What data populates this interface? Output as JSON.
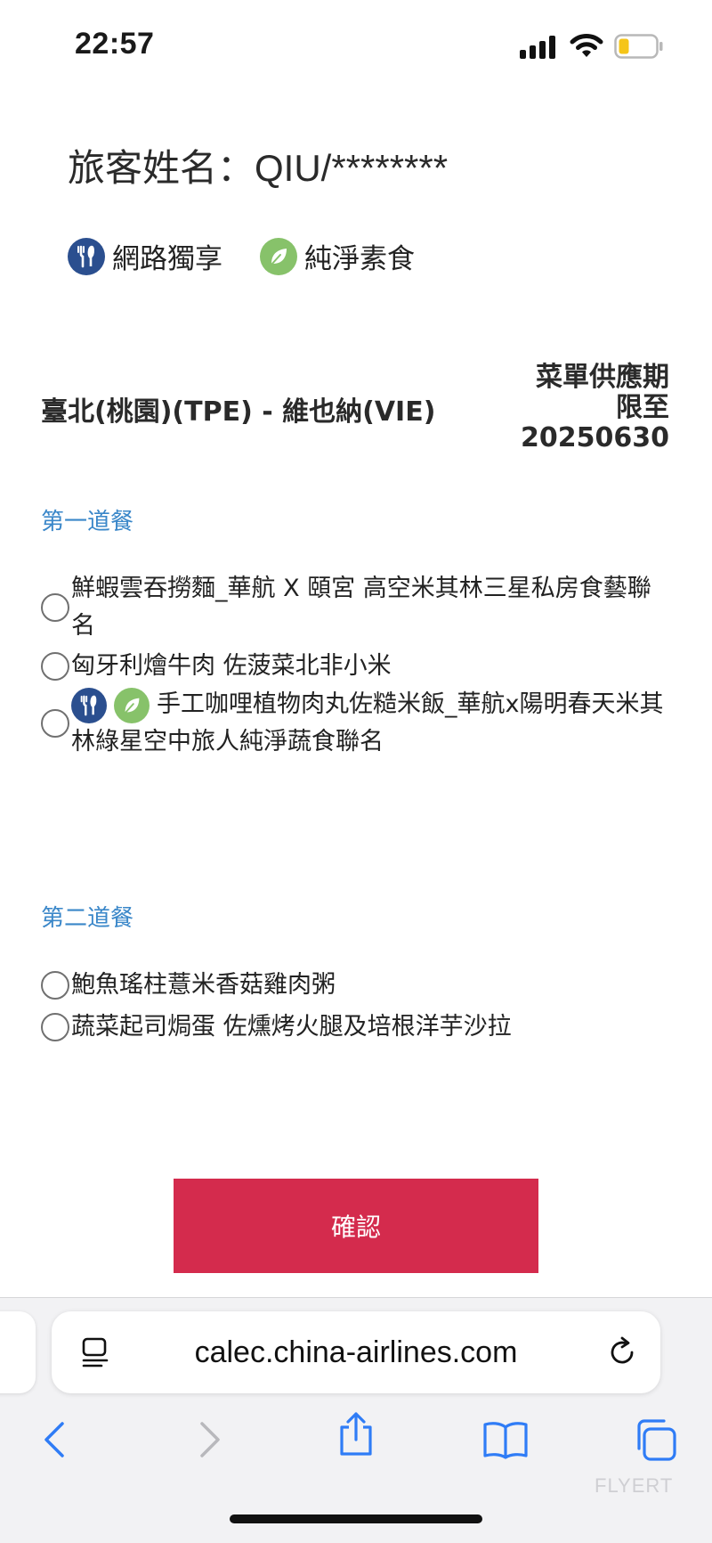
{
  "status_bar": {
    "time": "22:57",
    "battery_color": "#f5c518"
  },
  "passenger": {
    "label": "旅客姓名：QIU/********"
  },
  "legend": {
    "online_exclusive": "網路獨享",
    "pure_vegetarian": "純淨素食"
  },
  "flight": {
    "route": "臺北(桃園)(TPE) - 維也納(VIE)",
    "supply_line1": "菜單供應期",
    "supply_line2": "限至",
    "supply_date": "20250630"
  },
  "section1": {
    "title": "第一道餐",
    "options": [
      {
        "label": "鮮蝦雲吞撈麵_華航 X 頤宮 高空米其林三星私房食藝聯名"
      },
      {
        "label": "匈牙利燴牛肉 佐菠菜北非小米"
      },
      {
        "label": "手工咖哩植物肉丸佐糙米飯_華航x陽明春天米其林綠星空中旅人純淨蔬食聯名",
        "badges": [
          "fork-knife-icon",
          "leaf-icon"
        ]
      }
    ]
  },
  "section2": {
    "title": "第二道餐",
    "options": [
      {
        "label": "鮑魚瑤柱薏米香菇雞肉粥"
      },
      {
        "label": "蔬菜起司焗蛋 佐燻烤火腿及培根洋芋沙拉"
      }
    ]
  },
  "confirm": {
    "label": "確認",
    "color": "#d42b4d"
  },
  "browser": {
    "url": "calec.china-airlines.com"
  },
  "watermark": {
    "text": "FLYERT"
  },
  "colors": {
    "section_title": "#3a87c9",
    "badge_blue": "#2b4f8f",
    "badge_green": "#87c26a"
  }
}
